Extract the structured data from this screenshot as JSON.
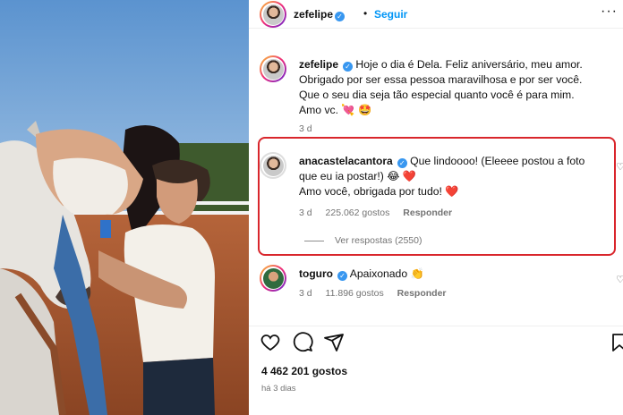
{
  "post": {
    "author": "zefelipe",
    "follow_label": "Seguir",
    "dot": "•",
    "more": "···"
  },
  "caption": {
    "username": "zefelipe",
    "text": "Hoje o dia é Dela. Feliz aniversário, meu amor. Obrigado por ser essa pessoa maravilhosa e por ser você. Que o seu dia seja tão especial quanto você é para mim.",
    "text2": "Amo vc. 💘 🤩",
    "time": "3 d"
  },
  "comments": [
    {
      "username": "anacastelacantora",
      "text": "Que lindoooo! (Eleeee postou a foto que eu ia postar!) 😂 ❤️",
      "text2": "Amo você, obrigada por tudo! ❤️",
      "time": "3 d",
      "likes": "225.062 gostos",
      "reply": "Responder",
      "view_replies": "Ver respostas (2550)"
    },
    {
      "username": "toguro",
      "text": "Apaixonado 👏",
      "time": "3 d",
      "likes": "11.896 gostos",
      "reply": "Responder"
    }
  ],
  "footer": {
    "likes": "4 462 201 gostos",
    "posted": "há 3 dias"
  },
  "colors": {
    "accent": "#0095f6",
    "verified": "#3897f0",
    "highlight": "#d9262c",
    "muted": "#737373"
  },
  "icons": [
    "heart-icon",
    "comment-icon",
    "share-icon",
    "bookmark-icon",
    "verified-icon"
  ]
}
